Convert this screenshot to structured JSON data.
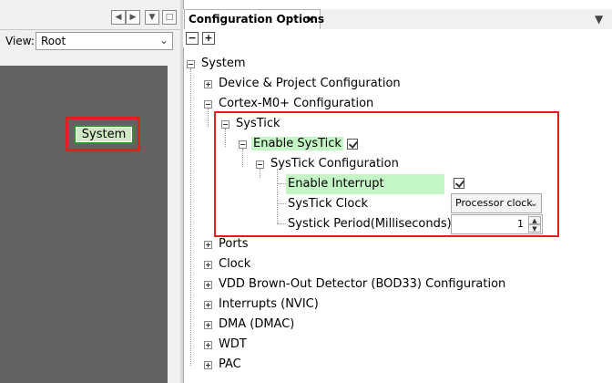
{
  "left": {
    "view_label": "View:",
    "view_value": "Root",
    "node_label": "System"
  },
  "right": {
    "tab_title": "Configuration Options",
    "tab_close": "×",
    "tree": {
      "system": "System",
      "device_project": "Device & Project Configuration",
      "cortex": "Cortex-M0+ Configuration",
      "systick": "SysTick",
      "enable_systick": "Enable SysTick",
      "systick_config": "SysTick Configuration",
      "enable_interrupt": "Enable Interrupt",
      "systick_clock": "SysTick Clock",
      "systick_clock_value": "Processor clock",
      "systick_period": "Systick Period(Milliseconds)",
      "systick_period_value": "1",
      "ports": "Ports",
      "clock": "Clock",
      "vdd": "VDD Brown-Out Detector (BOD33) Configuration",
      "interrupts": "Interrupts (NVIC)",
      "dma": "DMA (DMAC)",
      "wdt": "WDT",
      "pac": "PAC"
    }
  },
  "colors": {
    "highlight_green": "#c4f5c4",
    "annotation_red": "#e02020",
    "canvas_gray": "#626262"
  }
}
